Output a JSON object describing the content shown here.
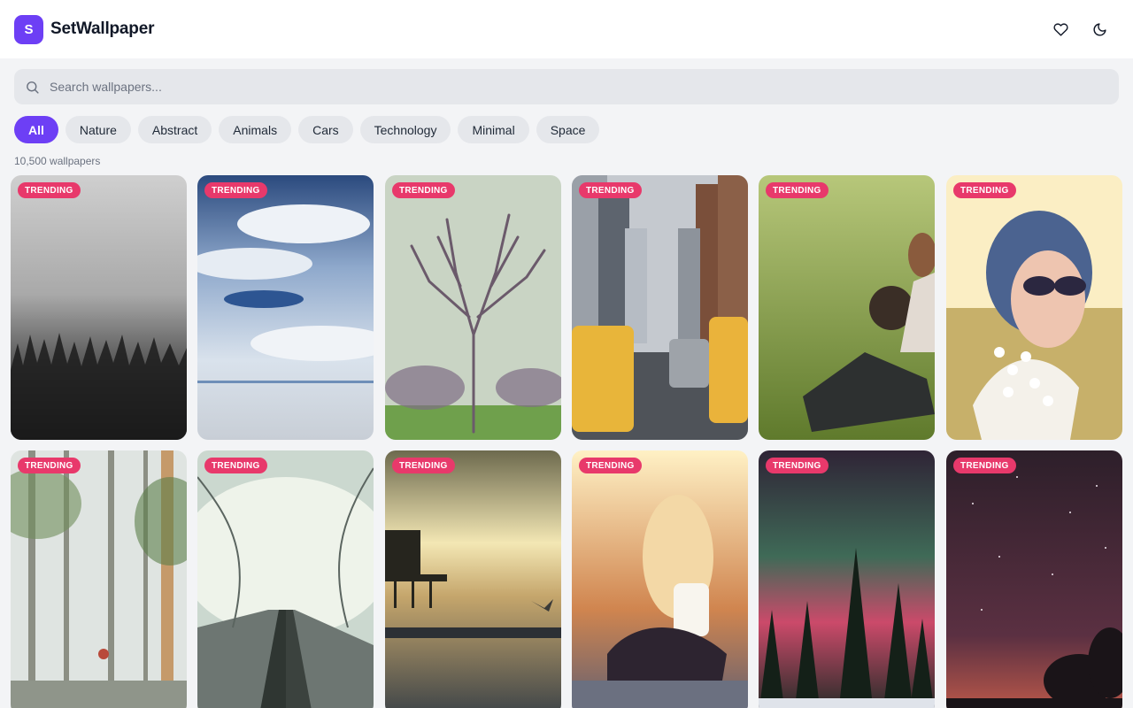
{
  "app": {
    "logo_letter": "S",
    "title": "SetWallpaper"
  },
  "header": {
    "icons": [
      "heart-icon",
      "moon-icon"
    ]
  },
  "search": {
    "placeholder": "Search wallpapers...",
    "value": ""
  },
  "categories": [
    {
      "label": "All",
      "active": true
    },
    {
      "label": "Nature",
      "active": false
    },
    {
      "label": "Abstract",
      "active": false
    },
    {
      "label": "Animals",
      "active": false
    },
    {
      "label": "Cars",
      "active": false
    },
    {
      "label": "Technology",
      "active": false
    },
    {
      "label": "Minimal",
      "active": false
    },
    {
      "label": "Space",
      "active": false
    }
  ],
  "result_count": "10,500 wallpapers",
  "badge_label": "TRENDING",
  "colors": {
    "accent": "#6d3ff5",
    "badge": "#e8396b"
  },
  "wallpapers": [
    {
      "scene": "misty-forest"
    },
    {
      "scene": "clouds-reflection"
    },
    {
      "scene": "bare-tree"
    },
    {
      "scene": "city-taxis"
    },
    {
      "scene": "grass-dog"
    },
    {
      "scene": "girl-sunglasses-flowers"
    },
    {
      "scene": "foggy-birch-forest"
    },
    {
      "scene": "railway-fog"
    },
    {
      "scene": "pier-sunset"
    },
    {
      "scene": "girl-sunlight"
    },
    {
      "scene": "aurora-trees"
    },
    {
      "scene": "starry-night"
    }
  ]
}
